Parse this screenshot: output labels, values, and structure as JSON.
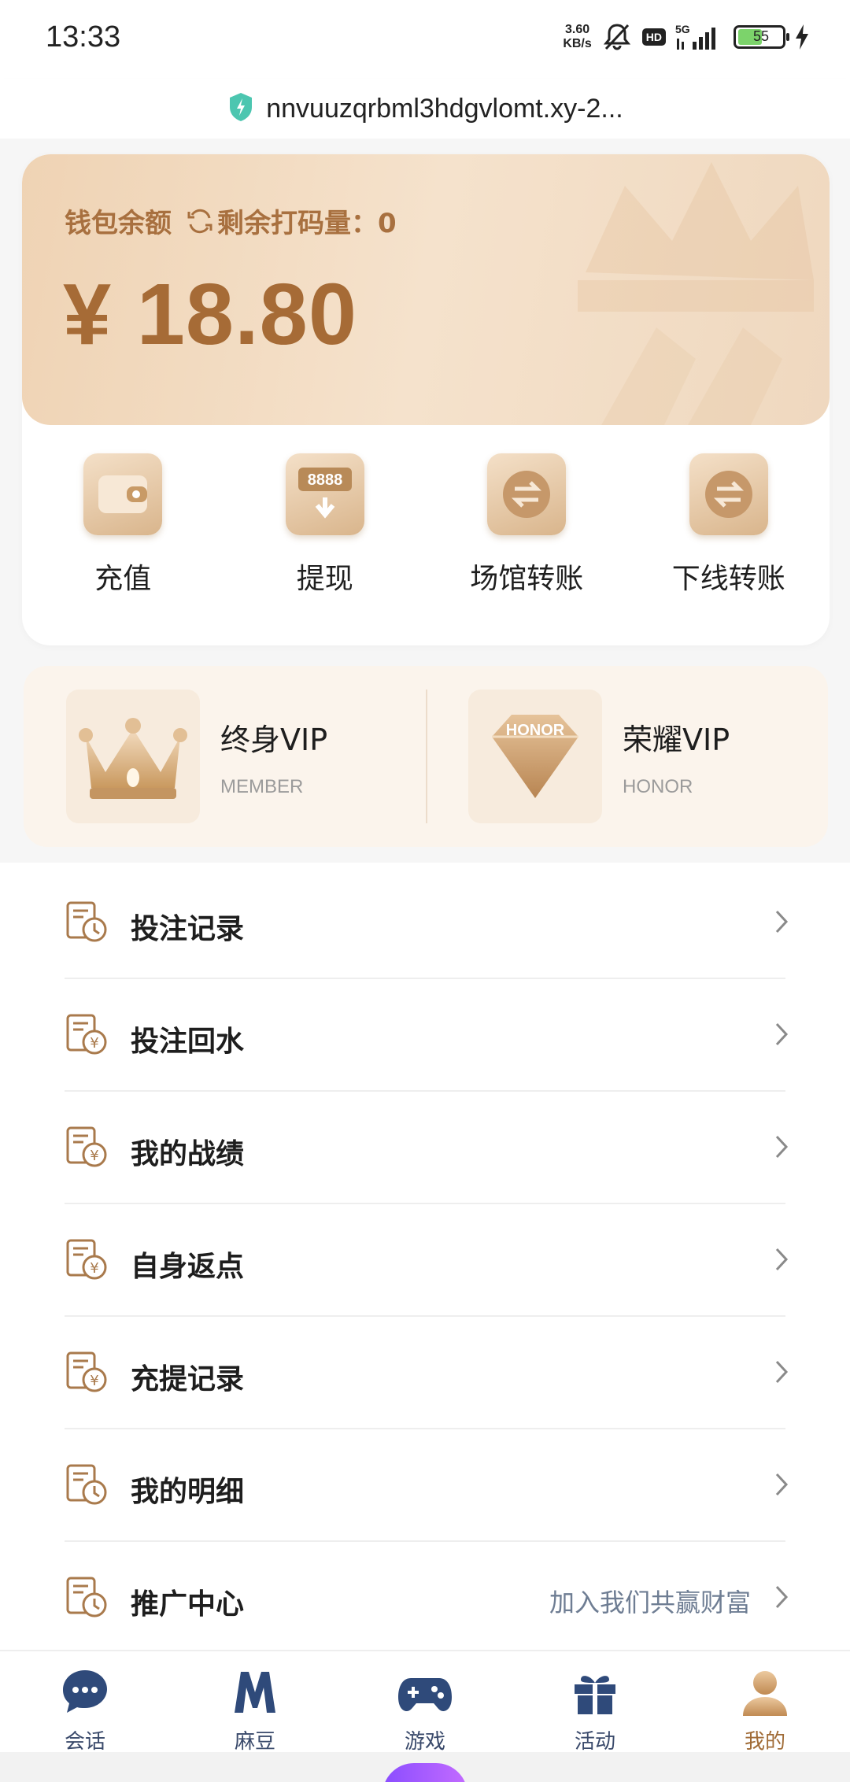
{
  "status_bar": {
    "time": "13:33",
    "net_speed_value": "3.60",
    "net_speed_unit": "KB/s",
    "hd": "HD",
    "network": "5G",
    "battery_level": "55"
  },
  "url_bar": {
    "url": "nnvuuzqrbml3hdgvlomt.xy-2..."
  },
  "wallet": {
    "balance_label": "钱包余额",
    "remaining_label": "剩余打码量：0",
    "amount": "¥ 18.80",
    "actions": [
      {
        "label": "充值",
        "icon": "wallet-icon"
      },
      {
        "label": "提现",
        "icon": "withdraw-8888-icon"
      },
      {
        "label": "场馆转账",
        "icon": "transfer-icon"
      },
      {
        "label": "下线转账",
        "icon": "transfer-icon"
      }
    ]
  },
  "vip": [
    {
      "title": "终身VIP",
      "subtitle": "MEMBER",
      "icon": "crown-icon"
    },
    {
      "title": "荣耀VIP",
      "subtitle": "HONOR",
      "icon": "honor-diamond-icon",
      "badge_text": "HONOR"
    }
  ],
  "menu": [
    {
      "label": "投注记录",
      "extra": "",
      "icon": "clock-document-icon"
    },
    {
      "label": "投注回水",
      "extra": "",
      "icon": "yen-document-icon"
    },
    {
      "label": "我的战绩",
      "extra": "",
      "icon": "yen-document-icon"
    },
    {
      "label": "自身返点",
      "extra": "",
      "icon": "yen-document-icon"
    },
    {
      "label": "充提记录",
      "extra": "",
      "icon": "yen-document-icon"
    },
    {
      "label": "我的明细",
      "extra": "",
      "icon": "clock-document-icon"
    },
    {
      "label": "推广中心",
      "extra": "加入我们共赢财富",
      "icon": "clock-document-icon"
    }
  ],
  "tabs": [
    {
      "label": "会话",
      "icon": "chat-icon",
      "active": false
    },
    {
      "label": "麻豆",
      "icon": "madou-m-icon",
      "active": false
    },
    {
      "label": "游戏",
      "icon": "gamepad-icon",
      "active": false
    },
    {
      "label": "活动",
      "icon": "gift-icon",
      "active": false
    },
    {
      "label": "我的",
      "icon": "user-icon",
      "active": true
    }
  ],
  "colors": {
    "accent_gold": "#a66b36",
    "tab_inactive": "#3a4a6b",
    "extra_text": "#6e7d93"
  }
}
